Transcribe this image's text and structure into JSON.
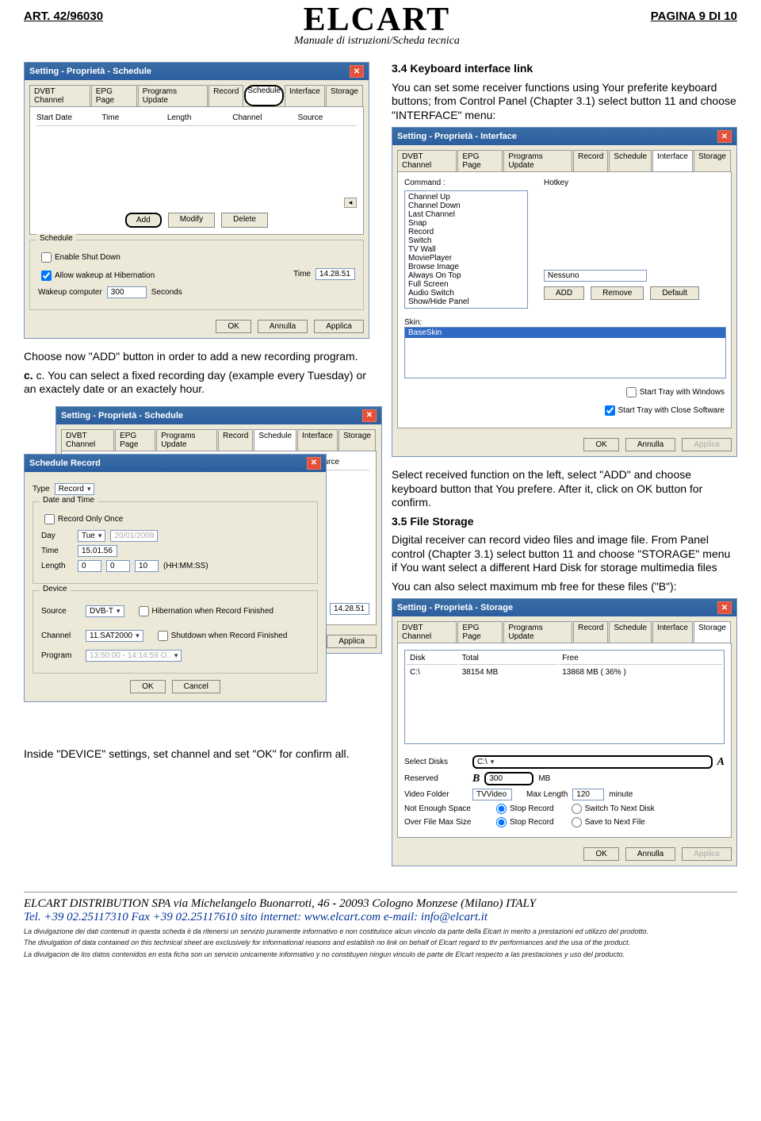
{
  "header": {
    "art": "ART. 42/96030",
    "brand": "ELCART",
    "subtitle": "Manuale di istruzioni/Scheda tecnica",
    "pagina": "PAGINA 9 DI 10"
  },
  "text": {
    "sec34_title": "3.4 Keyboard interface link",
    "sec34_p1": "You can set some receiver functions using Your preferite keyboard buttons; from Control Panel (Chapter 3.1) select button 11 and choose \"INTERFACE\" menu:",
    "choose_add": "Choose now \"ADD\" button in order to add a new recording program.",
    "c_para": "c. You can select a fixed recording day (example every Tuesday) or an exactely date or an exactely hour.",
    "select_received": "Select received function on the left, select \"ADD\" and choose keyboard button that You prefere. After it, click on OK button for confirm.",
    "sec35_title": "3.5 File Storage",
    "sec35_p": "Digital receiver can record video files and image file. From Panel control (Chapter 3.1) select button 11 and choose \"STORAGE\" menu if You want select a different Hard Disk for storage multimedia files",
    "sec35_p2": "You can also select maximum mb free for these files (\"B\"):",
    "inside_device": "Inside \"DEVICE\" settings, set channel and set \"OK\" for confirm all."
  },
  "common": {
    "tabs": [
      "DVBT Channel",
      "EPG Page",
      "Programs Update",
      "Record",
      "Schedule",
      "Interface",
      "Storage"
    ],
    "ok": "OK",
    "annulla": "Annulla",
    "applica": "Applica",
    "add": "Add",
    "modify": "Modify",
    "delete": "Delete",
    "cancel": "Cancel"
  },
  "win_schedule": {
    "title": "Setting - Proprietà - Schedule",
    "cols": [
      "Start Date",
      "Time",
      "Length",
      "Channel",
      "Source"
    ],
    "group": "Schedule",
    "enable_shutdown": "Enable Shut Down",
    "allow_wakeup": "Allow wakeup at Hibernation",
    "wakeup_computer": "Wakeup computer",
    "wakeup_value": "300",
    "seconds": "Seconds",
    "time_label": "Time",
    "time_value": "14.28.51"
  },
  "win_interface": {
    "title": "Setting - Proprietà - Interface",
    "command": "Command :",
    "hotkey": "Hotkey",
    "commands": [
      "Channel Up",
      "Channel Down",
      "Last Channel",
      "Snap",
      "Record",
      "Switch",
      "TV Wall",
      "MoviePlayer",
      "Browse Image",
      "Always On Top",
      "Full Screen",
      "Audio Switch",
      "Show/Hide Panel"
    ],
    "hotkey_value": "Nessuno",
    "btn_add": "ADD",
    "btn_remove": "Remove",
    "btn_default": "Default",
    "skin_label": "Skin:",
    "skin_value": "BaseSkin",
    "start_tray_win": "Start Tray with Windows",
    "start_tray_close": "Start Tray with Close Software"
  },
  "win_sched_record": {
    "title_back": "Setting - Proprietà - Schedule",
    "title_front": "Schedule Record",
    "type_label": "Type",
    "type_value": "Record",
    "date_time_group": "Date and Time",
    "record_only_once": "Record Only Once",
    "day_label": "Day",
    "day_value": "Tue",
    "date_disabled": "20/01/2009",
    "time_label": "Time",
    "time_value": "15.01.56",
    "length_label": "Length",
    "length_h": "0",
    "length_m": "0",
    "length_s": "10",
    "length_hint": "(HH:MM:SS)",
    "device_group": "Device",
    "source_label": "Source",
    "source_value": "DVB-T",
    "hib_finish": "Hibernation when Record Finished",
    "shut_finish": "Shutdown when Record Finished",
    "channel_label": "Channel",
    "channel_value": "11.SAT2000",
    "program_label": "Program",
    "program_value": "13:50:00 - 14:14:59 O..",
    "back_time": "14.28.51"
  },
  "win_storage": {
    "title": "Setting - Proprietà - Storage",
    "col_disk": "Disk",
    "col_total": "Total",
    "col_free": "Free",
    "row_disk": "C:\\",
    "row_total": "38154 MB",
    "row_free": "13868 MB ( 36% )",
    "select_disks": "Select Disks",
    "select_disks_val": "C:\\",
    "reserved": "Reserved",
    "reserved_val": "300",
    "mb": "MB",
    "video_folder": "Video Folder",
    "video_folder_val": "TVVideo",
    "max_length": "Max Length",
    "max_length_val": "120",
    "minute": "minute",
    "not_enough": "Not Enough Space",
    "over_max": "Over File Max Size",
    "stop_record": "Stop Record",
    "switch_next": "Switch To Next Disk",
    "save_next": "Save to Next File",
    "markerA": "A",
    "markerB": "B"
  },
  "footer": {
    "line1": "ELCART DISTRIBUTION SPA  via Michelangelo Buonarroti, 46 - 20093 Cologno Monzese (Milano) ITALY",
    "line2": "Tel. +39 02.25117310 Fax +39 02.25117610 sito internet: www.elcart.com    e-mail: info@elcart.it",
    "disc1": "La divulgazione dei dati contenuti in questa scheda è da ritenersi un servizio puramente informativo e non costituisce alcun vincolo da parte della Elcart in merito a prestazioni ed utilizzo del prodotto.",
    "disc2": "The divulgation of data contained on this technical sheet are exclusively for informational reasons and establish no link on behalf of Elcart regard to thr performances and the usa of the product.",
    "disc3": "La divulgacion de los datos contenidos en esta ficha son un servicio unicamente informativo y no constituyen ningun vinculo de parte de Elcart respecto a las prestaciones y uso del producto."
  }
}
